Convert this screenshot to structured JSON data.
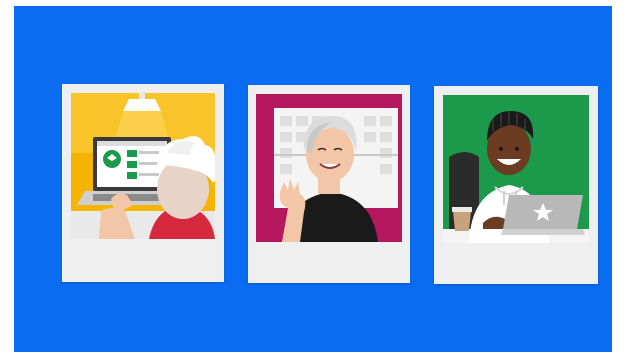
{
  "colors": {
    "background": "#0a6cf0",
    "photo_frame": "#efefef",
    "scene1_backdrop": "#f5b400",
    "scene2_backdrop": "#b5185e",
    "scene3_backdrop": "#1b9a4b"
  },
  "photos": [
    {
      "scene": "person-at-laptop-scene",
      "icon": "laptop-icon"
    },
    {
      "scene": "waving-woman-scene",
      "icon": "hand-wave-icon"
    },
    {
      "scene": "smiling-man-laptop-scene",
      "icon": "star-icon"
    }
  ]
}
